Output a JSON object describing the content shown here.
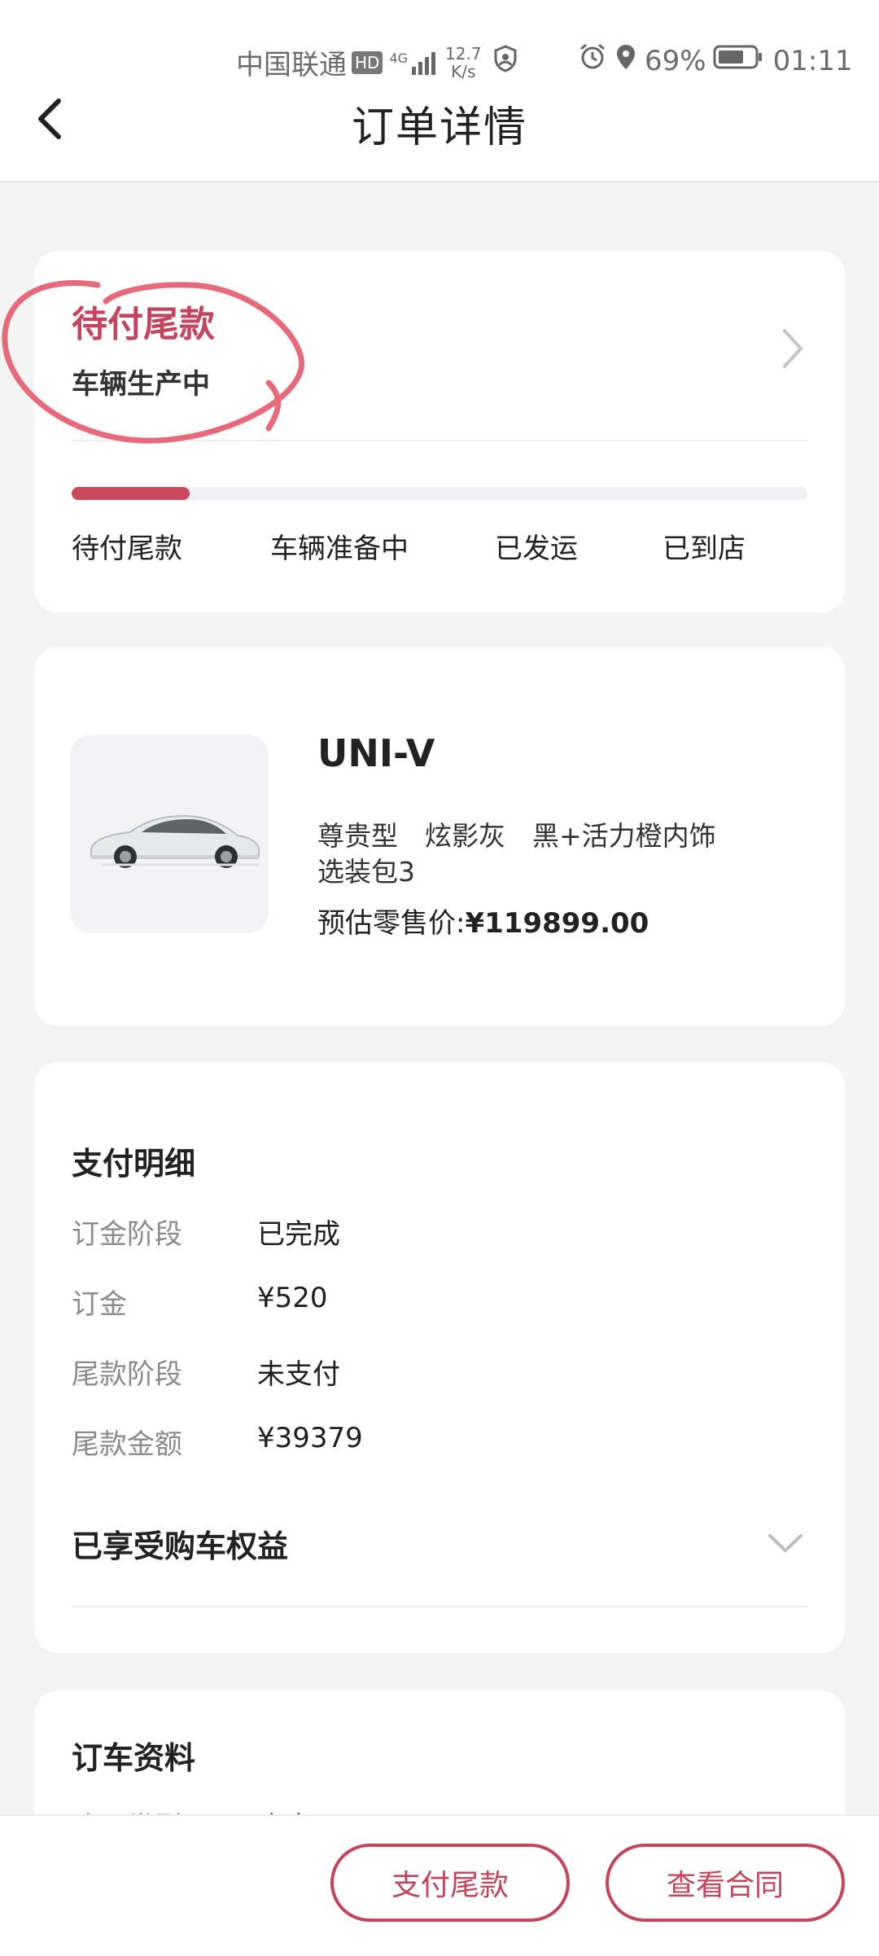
{
  "status_bar": {
    "carrier": "中国联通",
    "hd": "HD",
    "net_type": "4G",
    "speed_value": "12.7",
    "speed_unit": "K/s",
    "battery_percent": "69%",
    "time": "01:11"
  },
  "header": {
    "title": "订单详情"
  },
  "status_card": {
    "status_title": "待付尾款",
    "status_subtitle": "车辆生产中",
    "progress_fraction": 0.16,
    "steps": [
      "待付尾款",
      "车辆准备中",
      "已发运",
      "已到店"
    ]
  },
  "vehicle_card": {
    "model": "UNI-V",
    "config_line1": "尊贵型　炫影灰　黑+活力橙内饰",
    "config_line2": "选装包3",
    "price_label": "预估零售价:",
    "price_value": "¥119899.00"
  },
  "payment_card": {
    "title": "支付明细",
    "rows": [
      {
        "label": "订金阶段",
        "value": "已完成"
      },
      {
        "label": "订金",
        "value": "¥520"
      },
      {
        "label": "尾款阶段",
        "value": "未支付"
      },
      {
        "label": "尾款金额",
        "value": "¥39379"
      }
    ],
    "benefits_label": "已享受购车权益"
  },
  "order_info_card": {
    "title": "订车资料",
    "partial_label": "购买类型",
    "partial_value": "个人"
  },
  "bottom_bar": {
    "pay_button": "支付尾款",
    "contract_button": "查看合同"
  },
  "colors": {
    "accent": "#c3445c",
    "page_bg": "#f4f4f5",
    "annotation": "#e8697a"
  }
}
